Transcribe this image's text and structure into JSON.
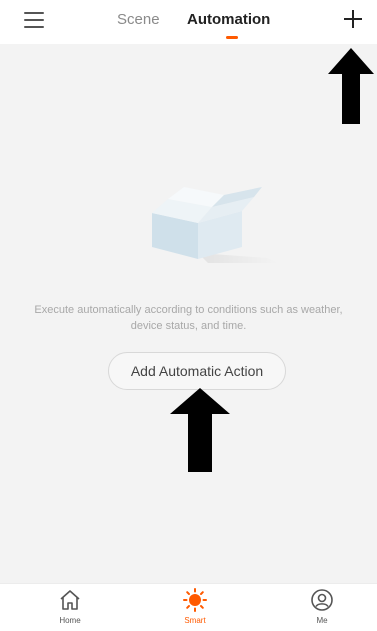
{
  "header": {
    "tabs": [
      {
        "label": "Scene",
        "active": false
      },
      {
        "label": "Automation",
        "active": true
      }
    ],
    "icons": {
      "menu": "hamburger-icon",
      "add": "plus-icon"
    }
  },
  "empty_state": {
    "illustration": "open-box-icon",
    "message": "Execute automatically according to conditions such as weather, device status, and time.",
    "button_label": "Add Automatic Action"
  },
  "bottom_nav": {
    "items": [
      {
        "label": "Home",
        "icon": "home-icon",
        "active": false
      },
      {
        "label": "Smart",
        "icon": "sun-icon",
        "active": true
      },
      {
        "label": "Me",
        "icon": "user-icon",
        "active": false
      }
    ]
  },
  "colors": {
    "accent": "#ff5a00",
    "background": "#f3f3f3",
    "muted_text": "#a8a8a8"
  }
}
